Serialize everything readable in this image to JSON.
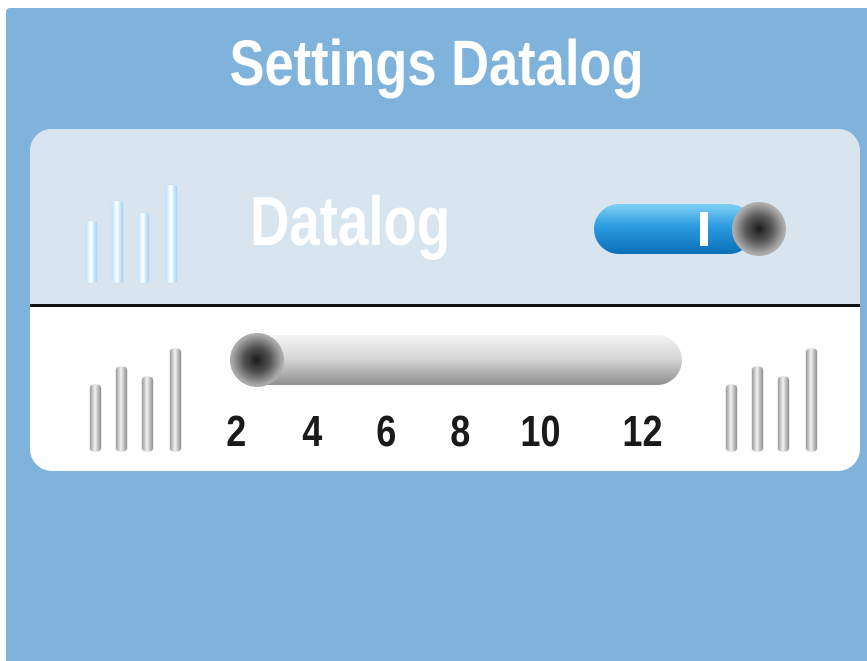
{
  "app": {
    "title": "Settings Datalog"
  },
  "datalog_row": {
    "label": "Datalog",
    "toggle": {
      "state": "on",
      "icon": "toggle-switch"
    }
  },
  "interval_slider": {
    "value": 2,
    "min": 2,
    "max": 12,
    "ticks": [
      "2",
      "4",
      "6",
      "8",
      "10",
      "12"
    ]
  },
  "icons": {
    "top_left": "signal-bars-icon",
    "bottom_left": "signal-bars-icon",
    "bottom_right": "signal-bars-icon"
  },
  "colors": {
    "background": "#7fb3dc",
    "panel_top": "#d8e4ee",
    "panel_bottom": "#ffffff",
    "toggle_on": "#2b9be0",
    "text_dark": "#1a1a1a"
  }
}
